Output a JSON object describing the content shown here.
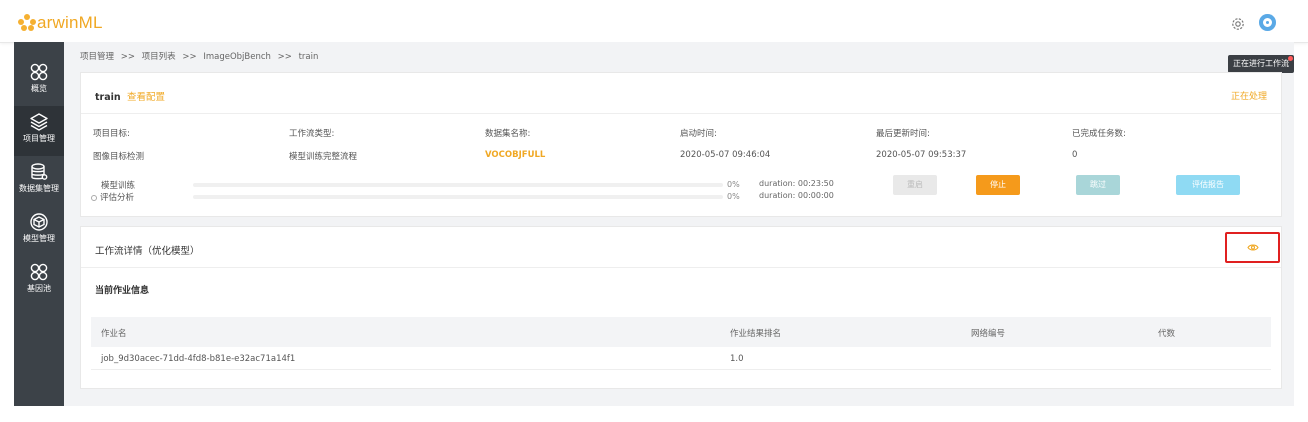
{
  "header": {
    "logo_prefix": "arwin",
    "logo_suffix": "ML"
  },
  "nav": [
    {
      "label": "概览",
      "icon": "grid-icon"
    },
    {
      "label": "项目管理",
      "icon": "layers-icon"
    },
    {
      "label": "数据集管理",
      "icon": "database-icon"
    },
    {
      "label": "模型管理",
      "icon": "cube-icon"
    },
    {
      "label": "基因池",
      "icon": "grid-icon"
    }
  ],
  "breadcrumb": [
    "项目管理",
    ">>",
    "项目列表",
    ">>",
    "ImageObjBench",
    ">>",
    "train"
  ],
  "tooltip": "正在进行工作流",
  "task": {
    "name": "train",
    "view_config": "查看配置",
    "status": "正在处理",
    "info": [
      {
        "label": "项目目标:",
        "value": "图像目标检测"
      },
      {
        "label": "工作流类型:",
        "value": "模型训练完整流程"
      },
      {
        "label": "数据集名称:",
        "value": "VOCOBJFULL"
      },
      {
        "label": "启动时间:",
        "value": "2020-05-07 09:46:04"
      },
      {
        "label": "最后更新时间:",
        "value": "2020-05-07 09:53:37"
      },
      {
        "label": "已完成任务数:",
        "value": "0"
      }
    ],
    "stages": [
      {
        "name": "模型训练",
        "percent": "0%",
        "duration": "duration: 00:23:50"
      },
      {
        "name": "评估分析",
        "percent": "0%",
        "duration": "duration: 00:00:00"
      }
    ],
    "buttons": {
      "restart": "重启",
      "stop": "停止",
      "skip": "跳过",
      "report": "评估报告"
    }
  },
  "workflow": {
    "title": "工作流详情（优化模型）",
    "subtitle": "当前作业信息",
    "columns": [
      "作业名",
      "作业结果排名",
      "网络编号",
      "代数"
    ],
    "rows": [
      {
        "job": "job_9d30acec-71dd-4fd8-b81e-e32ac71a14f1",
        "rank": "1.0",
        "net": "",
        "gen": ""
      }
    ]
  },
  "colors": {
    "accent": "#f0a824",
    "sidebar": "#3c4248",
    "highlight": "#e02020"
  }
}
